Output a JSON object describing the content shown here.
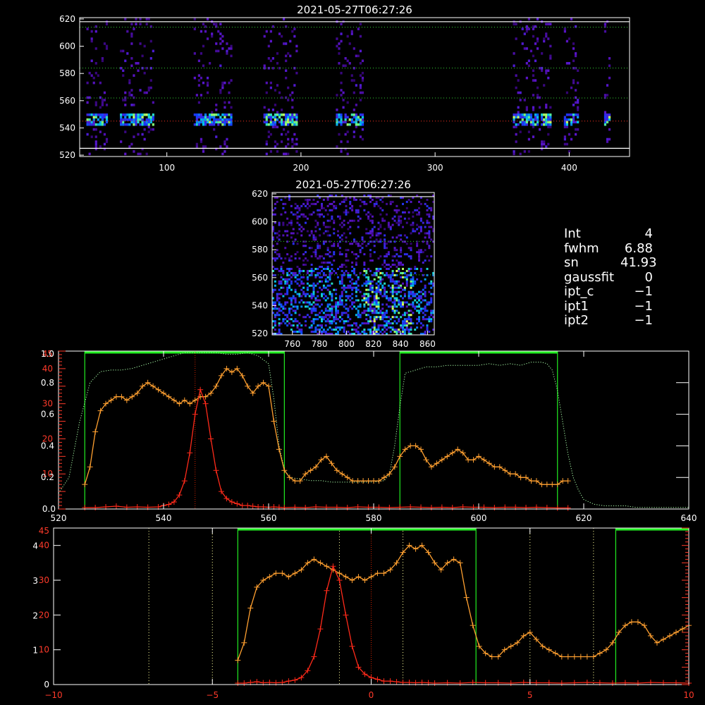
{
  "info_panel": [
    {
      "key": "Int",
      "value": "4"
    },
    {
      "key": "fwhm",
      "value": "6.88"
    },
    {
      "key": "sn",
      "value": "41.93"
    },
    {
      "key": "gaussfit",
      "value": "0"
    },
    {
      "key": "ipt_c",
      "value": "−1"
    },
    {
      "key": "ipt1",
      "value": "−1"
    },
    {
      "key": "ipt2",
      "value": "−1"
    }
  ],
  "colors": {
    "background": "#000000",
    "axes": "#ffffff",
    "orange_series": "#ffa030",
    "red_series": "#ff2a1a",
    "green_window": "#22ee22",
    "dotted_profile": "#aaffaa"
  },
  "chart_data": [
    {
      "type": "heatmap",
      "title": "2021-05-27T06:27:26",
      "xlim": [
        35,
        445
      ],
      "ylim": [
        519,
        621
      ],
      "x_ticks": [
        "100",
        "200",
        "300",
        "400"
      ],
      "y_ticks": [
        "520",
        "540",
        "560",
        "580",
        "600",
        "620"
      ],
      "bright_column_bands": [
        [
          40,
          56
        ],
        [
          65,
          90
        ],
        [
          120,
          148
        ],
        [
          172,
          196
        ],
        [
          226,
          246
        ],
        [
          358,
          386
        ],
        [
          396,
          406
        ],
        [
          426,
          430
        ]
      ],
      "emission_row": 545,
      "horizontal_lines": {
        "white": [
          525,
          618
        ],
        "green_dotted": [
          562,
          584,
          614
        ],
        "red_dotted": [
          545
        ]
      }
    },
    {
      "type": "heatmap",
      "title": "2021-05-27T06:27:26",
      "xlim": [
        745,
        865
      ],
      "ylim": [
        519,
        621
      ],
      "x_ticks": [
        "760",
        "780",
        "800",
        "820",
        "840",
        "860"
      ],
      "y_ticks": [
        "520",
        "540",
        "560",
        "580",
        "600",
        "620"
      ],
      "horizontal_lines": {
        "white": [
          618
        ],
        "green_dotted": [
          586,
          562
        ]
      }
    },
    {
      "type": "line",
      "xlim": [
        520,
        640
      ],
      "ylim_left": [
        0,
        45
      ],
      "ylim_right": [
        0,
        1
      ],
      "x_ticks": [
        "520",
        "540",
        "560",
        "580",
        "600",
        "620",
        "640"
      ],
      "y_ticks_left": [
        "0.0",
        "10",
        "20",
        "30",
        "40",
        "45"
      ],
      "y_ticks_right": [
        "0.2",
        "0.4",
        "0.6",
        "0.8",
        "0.2",
        "0.4",
        "0.6",
        "0.8",
        "1.0"
      ],
      "window_bars": [
        [
          525,
          563
        ],
        [
          585,
          615
        ]
      ],
      "center_marker": 546,
      "series": [
        {
          "x": [
            525,
            526,
            527,
            528,
            529,
            530,
            531,
            532,
            533,
            534,
            535,
            536,
            537,
            538,
            539,
            540,
            541,
            542,
            543,
            544,
            545,
            546,
            547,
            548,
            549,
            550,
            551,
            552,
            553,
            554,
            555,
            556,
            557,
            558,
            559,
            560,
            561,
            562,
            563,
            564,
            565,
            566,
            567,
            568,
            569,
            570,
            571,
            572,
            573,
            574,
            575,
            576,
            577,
            578,
            579,
            580,
            581,
            582,
            583,
            584,
            585,
            586,
            587,
            588,
            589,
            590,
            591,
            592,
            593,
            594,
            595,
            596,
            597,
            598,
            599,
            600,
            601,
            602,
            603,
            604,
            605,
            606,
            607,
            608,
            609,
            610,
            611,
            612,
            613,
            614,
            615,
            616,
            617
          ],
          "values": [
            7,
            12,
            22,
            28,
            30,
            31,
            32,
            32,
            31,
            32,
            33,
            35,
            36,
            35,
            34,
            33,
            32,
            31,
            30,
            31,
            30,
            31,
            32,
            32,
            33,
            35,
            38,
            40,
            39,
            40,
            38,
            35,
            33,
            35,
            36,
            35,
            25,
            17,
            11,
            9,
            8,
            8,
            10,
            11,
            12,
            14,
            15,
            13,
            11,
            10,
            9,
            8,
            8,
            8,
            8,
            8,
            8,
            9,
            10,
            12,
            15,
            17,
            18,
            18,
            17,
            14,
            12,
            13,
            14,
            15,
            16,
            17,
            16,
            14,
            14,
            15,
            14,
            13,
            12,
            12,
            11,
            10,
            10,
            9,
            9,
            8,
            8,
            7,
            7,
            7,
            7,
            8,
            8
          ]
        },
        {
          "x": [
            525,
            527,
            529,
            531,
            533,
            535,
            537,
            539,
            540,
            541,
            542,
            543,
            544,
            545,
            546,
            547,
            548,
            549,
            550,
            551,
            552,
            553,
            554,
            555,
            556,
            557,
            558,
            559,
            560,
            561,
            562,
            563,
            565,
            567,
            569,
            571,
            573,
            575,
            577,
            579,
            581,
            583,
            585,
            587,
            589,
            591,
            593,
            595,
            597,
            599,
            601,
            603,
            605,
            607,
            609,
            611,
            613,
            615,
            617
          ],
          "values": [
            0.4,
            0.4,
            0.6,
            0.8,
            0.5,
            0.6,
            0.5,
            0.6,
            1.0,
            1.3,
            2,
            4,
            8,
            16,
            27,
            34,
            30,
            20,
            11,
            5,
            3,
            2,
            1.5,
            1,
            1,
            0.8,
            0.6,
            0.6,
            0.5,
            0.6,
            0.5,
            0.4,
            0.5,
            0.4,
            0.6,
            0.5,
            0.5,
            0.4,
            0.6,
            0.5,
            0.5,
            0.4,
            0.5,
            0.6,
            0.5,
            0.4,
            0.5,
            0.4,
            0.6,
            0.5,
            0.5,
            0.4,
            0.5,
            0.5,
            0.4,
            0.5,
            0.4,
            0.3,
            0.3
          ]
        },
        {
          "x": [
            520,
            522,
            524,
            526,
            528,
            530,
            532,
            534,
            536,
            538,
            540,
            542,
            544,
            546,
            548,
            550,
            552,
            554,
            556,
            558,
            560,
            561,
            562,
            563,
            564,
            566,
            568,
            570,
            572,
            574,
            576,
            578,
            580,
            582,
            583,
            584,
            585,
            586,
            588,
            590,
            592,
            594,
            596,
            598,
            600,
            602,
            604,
            606,
            608,
            610,
            612,
            613,
            614,
            615,
            616,
            617,
            618,
            619,
            620,
            622,
            624,
            626,
            628,
            630,
            632,
            634,
            636,
            638,
            640
          ],
          "values": [
            0.1,
            0.2,
            0.55,
            0.8,
            0.87,
            0.88,
            0.88,
            0.89,
            0.91,
            0.93,
            0.95,
            0.97,
            0.99,
            0.99,
            0.99,
            0.99,
            0.98,
            0.98,
            0.99,
            0.97,
            0.92,
            0.7,
            0.4,
            0.25,
            0.2,
            0.19,
            0.18,
            0.18,
            0.17,
            0.17,
            0.17,
            0.17,
            0.17,
            0.18,
            0.22,
            0.4,
            0.65,
            0.86,
            0.88,
            0.9,
            0.9,
            0.91,
            0.91,
            0.91,
            0.91,
            0.92,
            0.91,
            0.92,
            0.91,
            0.93,
            0.93,
            0.92,
            0.88,
            0.75,
            0.55,
            0.35,
            0.2,
            0.12,
            0.06,
            0.03,
            0.02,
            0.02,
            0.02,
            0.01,
            0.01,
            0.01,
            0.01,
            0.01,
            0.01
          ]
        }
      ]
    },
    {
      "type": "line",
      "xlim": [
        -10,
        10
      ],
      "ylim_left": [
        0,
        45
      ],
      "ylim_right": [
        0,
        4.5
      ],
      "x_ticks": [
        "−10",
        "−5",
        "0",
        "5",
        "10"
      ],
      "y_ticks_left": [
        "0",
        "10",
        "20",
        "30",
        "40",
        "45"
      ],
      "y_ticks_right": [
        "1",
        "2",
        "3",
        "4"
      ],
      "window_bars": [
        [
          -4.2,
          3.3
        ],
        [
          7.7,
          10
        ]
      ],
      "dotted_verticals": [
        -7,
        -5,
        -1,
        1,
        5,
        7
      ],
      "center_marker": 0,
      "series": [
        {
          "x": [
            -4.2,
            -4.0,
            -3.8,
            -3.6,
            -3.4,
            -3.2,
            -3.0,
            -2.8,
            -2.6,
            -2.4,
            -2.2,
            -2.0,
            -1.8,
            -1.6,
            -1.4,
            -1.2,
            -1.0,
            -0.8,
            -0.6,
            -0.4,
            -0.2,
            0.0,
            0.2,
            0.4,
            0.6,
            0.8,
            1.0,
            1.2,
            1.4,
            1.6,
            1.8,
            2.0,
            2.2,
            2.4,
            2.6,
            2.8,
            3.0,
            3.2,
            3.4,
            3.6,
            3.8,
            4.0,
            4.2,
            4.4,
            4.6,
            4.8,
            5.0,
            5.2,
            5.4,
            5.6,
            5.8,
            6.0,
            6.2,
            6.4,
            6.6,
            6.8,
            7.0,
            7.2,
            7.4,
            7.6,
            7.8,
            8.0,
            8.2,
            8.4,
            8.6,
            8.8,
            9.0,
            9.2,
            9.4,
            9.6,
            9.8,
            10.0
          ],
          "values": [
            7,
            12,
            22,
            28,
            30,
            31,
            32,
            32,
            31,
            32,
            33,
            35,
            36,
            35,
            34,
            33,
            32,
            31,
            30,
            31,
            30,
            31,
            32,
            32,
            33,
            35,
            38,
            40,
            39,
            40,
            38,
            35,
            33,
            35,
            36,
            35,
            25,
            17,
            11,
            9,
            8,
            8,
            10,
            11,
            12,
            14,
            15,
            13,
            11,
            10,
            9,
            8,
            8,
            8,
            8,
            8,
            8,
            9,
            10,
            12,
            15,
            17,
            18,
            18,
            17,
            14,
            12,
            13,
            14,
            15,
            16,
            17
          ]
        },
        {
          "x": [
            -4.2,
            -4.0,
            -3.8,
            -3.6,
            -3.4,
            -3.2,
            -3.0,
            -2.8,
            -2.6,
            -2.4,
            -2.2,
            -2.0,
            -1.8,
            -1.6,
            -1.4,
            -1.2,
            -1.0,
            -0.8,
            -0.6,
            -0.4,
            -0.2,
            0.0,
            0.2,
            0.4,
            0.6,
            0.8,
            1.0,
            1.2,
            1.4,
            1.6,
            1.8,
            2.0,
            2.4,
            2.8,
            3.2,
            3.6,
            4.0,
            4.4,
            4.8,
            5.2,
            5.6,
            6.0,
            6.4,
            6.8,
            7.2,
            7.6,
            8.0,
            8.4,
            8.8,
            9.2,
            9.6,
            10.0
          ],
          "values": [
            0.4,
            0.4,
            0.6,
            0.8,
            0.5,
            0.6,
            0.5,
            0.6,
            1.0,
            1.3,
            2,
            4,
            8,
            16,
            27,
            34,
            30,
            20,
            11,
            5,
            3,
            2,
            1.5,
            1,
            1,
            0.8,
            0.6,
            0.6,
            0.5,
            0.6,
            0.5,
            0.4,
            0.5,
            0.4,
            0.6,
            0.5,
            0.5,
            0.4,
            0.6,
            0.5,
            0.5,
            0.4,
            0.5,
            0.6,
            0.5,
            0.4,
            0.5,
            0.4,
            0.6,
            0.5,
            0.5,
            0.4
          ]
        }
      ]
    }
  ]
}
